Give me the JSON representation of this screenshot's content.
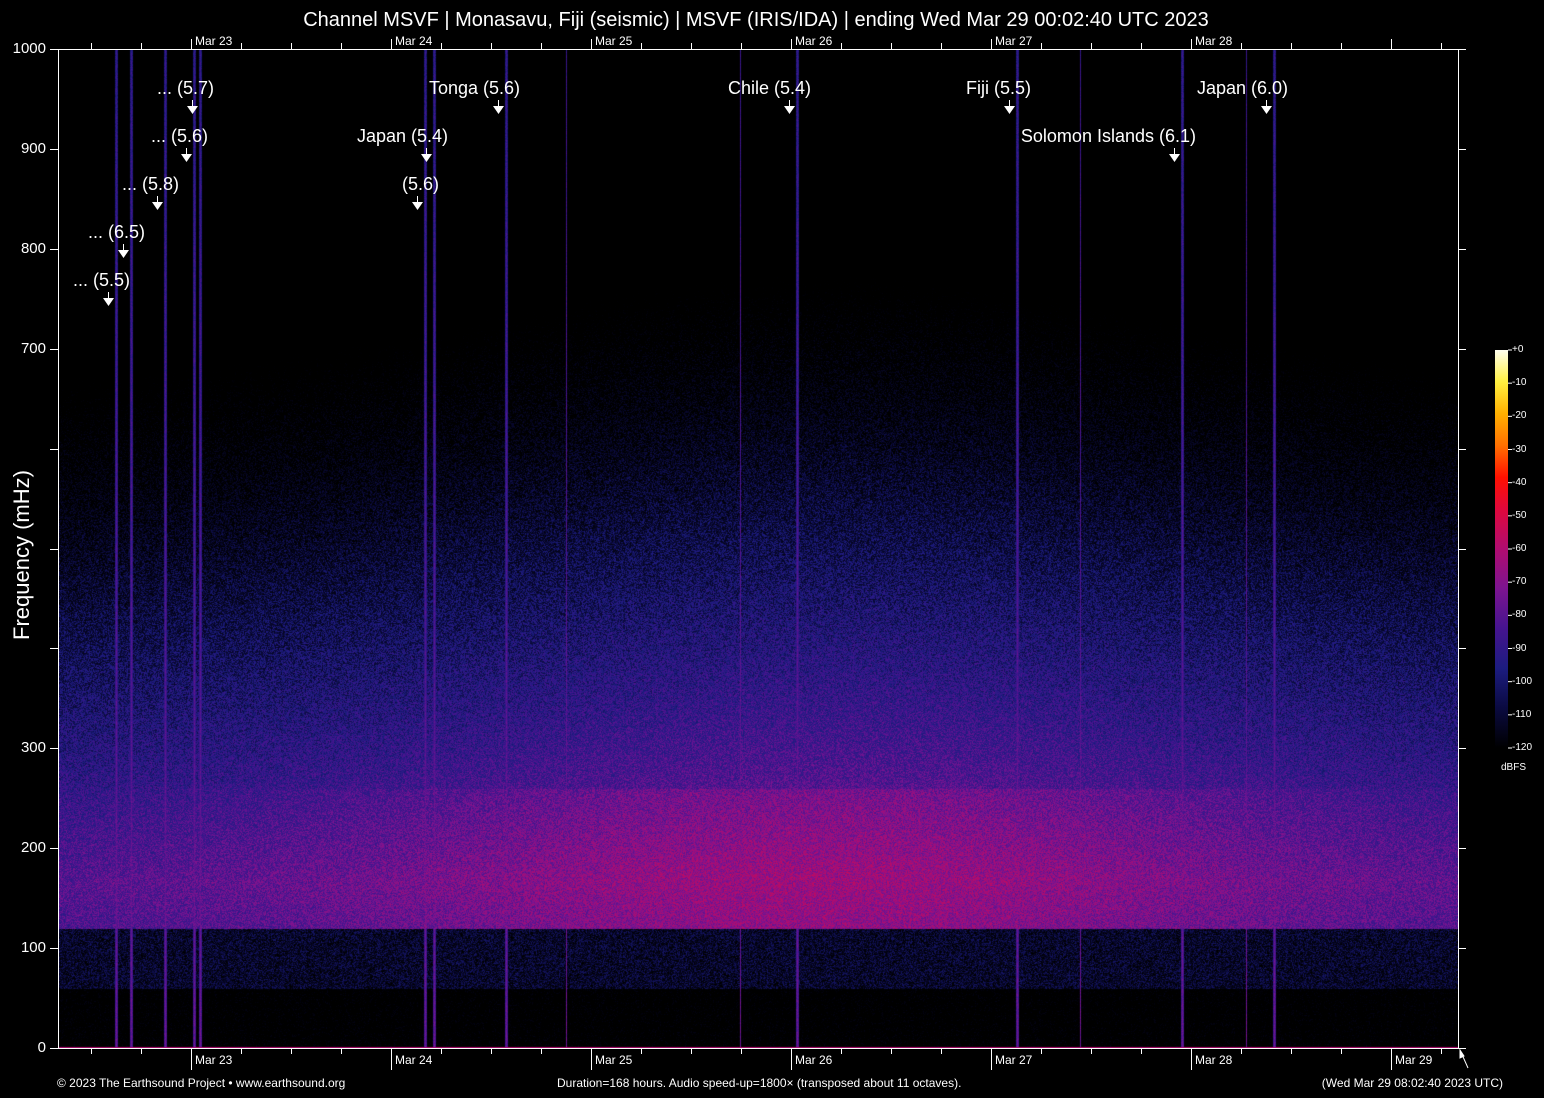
{
  "chart_data": {
    "type": "heatmap",
    "title": "Channel MSVF | Monasavu, Fiji (seismic) | MSVF (IRIS/IDA) | ending Wed Mar 29 00:02:40 UTC 2023",
    "xlabel": "",
    "ylabel": "Frequency (mHz)",
    "ylim": [
      0,
      1000
    ],
    "xlim_hours": [
      0,
      168
    ],
    "y_ticks": [
      0,
      100,
      200,
      300,
      400,
      500,
      600,
      700,
      800,
      900,
      1000
    ],
    "y_tick_labels": [
      "0",
      "100",
      "200",
      "300",
      "",
      "",
      "",
      "700",
      "800",
      "900",
      "1000"
    ],
    "x_tick_labels_top": [
      "Mar 23",
      "Mar 24",
      "Mar 25",
      "Mar 26",
      "Mar 27",
      "Mar 28"
    ],
    "x_tick_labels_bottom": [
      "Mar 23",
      "Mar 24",
      "Mar 25",
      "Mar 26",
      "Mar 27",
      "Mar 28",
      "Mar 29"
    ],
    "x_tick_hours": [
      16,
      40,
      64,
      88,
      112,
      136,
      160
    ],
    "colorbar": {
      "unit": "dBFS",
      "range": [
        -120,
        0
      ],
      "labels": [
        "+0",
        "-10",
        "-20",
        "-30",
        "-40",
        "-50",
        "-60",
        "-70",
        "-80",
        "-90",
        "-100",
        "-110",
        "-120"
      ]
    },
    "events": [
      {
        "label": "... (5.5)",
        "hours": 6.0
      },
      {
        "label": "... (6.5)",
        "hours": 7.8
      },
      {
        "label": "... (5.8)",
        "hours": 11.9
      },
      {
        "label": "... (5.6)",
        "hours": 15.4
      },
      {
        "label": "... (5.7)",
        "hours": 16.1
      },
      {
        "label": "(5.6)",
        "hours": 43.1
      },
      {
        "label": "Japan (5.4)",
        "hours": 44.2
      },
      {
        "label": "Tonga (5.6)",
        "hours": 52.8
      },
      {
        "label": "Chile (5.4)",
        "hours": 87.7
      },
      {
        "label": "Fiji (5.5)",
        "hours": 114.1
      },
      {
        "label": "Solomon Islands (6.1)",
        "hours": 133.9
      },
      {
        "label": "Japan (6.0)",
        "hours": 145.0
      }
    ],
    "noise_band_mhz": [
      100,
      250
    ]
  },
  "footer": {
    "copyright": "© 2023 The Earthsound Project • www.earthsound.org",
    "info": "Duration=168 hours. Audio speed-up=1800× (transposed about 11 octaves).",
    "timestamp": "(Wed Mar 29 08:02:40 2023 UTC)"
  }
}
